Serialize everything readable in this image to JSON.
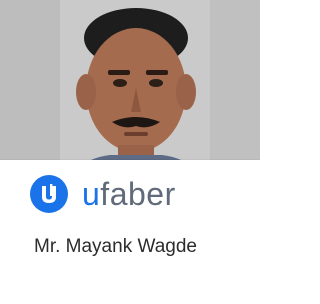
{
  "profile": {
    "name": "Mr. Mayank Wagde"
  },
  "brand": {
    "wordmark_prefix": "u",
    "wordmark_rest": "faber",
    "accent_color": "#1a73e8",
    "text_color": "#606a7a",
    "logo_icon": "ufaber-logo-icon"
  }
}
